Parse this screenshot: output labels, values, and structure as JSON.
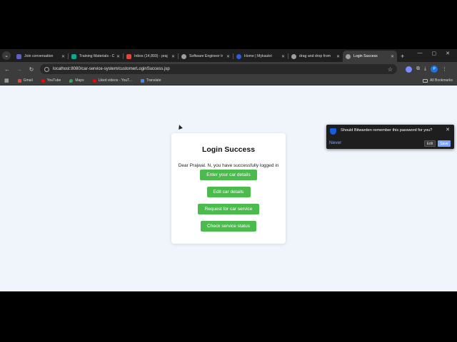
{
  "tabs": [
    {
      "title": "Join conversation",
      "color": "#5b5fc7",
      "active": false
    },
    {
      "title": "Training Materials - C",
      "color": "#0fa58e",
      "active": false
    },
    {
      "title": "Inbox (14,893) - praj",
      "color": "#ea4335",
      "active": false
    },
    {
      "title": "Software Engineer Ir",
      "color": "#9aa0a6",
      "active": false
    },
    {
      "title": "Home | Mykaukri",
      "color": "#2d5be3",
      "active": false
    },
    {
      "title": "drag and drop from",
      "color": "#9aa0a6",
      "active": false
    },
    {
      "title": "Login Success",
      "color": "#9aa0a6",
      "active": true
    }
  ],
  "toolbar": {
    "url": "localhost:8080/car-service-system/customerLoginSuccess.jsp",
    "avatar_letter": "P"
  },
  "bookmarks": [
    {
      "label": "Gmail",
      "color": "#ea4335"
    },
    {
      "label": "YouTube",
      "color": "#ff0000"
    },
    {
      "label": "Maps",
      "color": "#34a853"
    },
    {
      "label": "Liked videos - YouT...",
      "color": "#ff0000"
    },
    {
      "label": "Translate",
      "color": "#4285f4"
    }
  ],
  "all_bookmarks": "All Bookmarks",
  "card": {
    "title": "Login Success",
    "message": "Dear Prajwal. N, you have successfully logged in",
    "buttons": [
      "Enter your car details",
      "Edit car details",
      "Request for car service",
      "Check service status"
    ]
  },
  "bitwarden": {
    "message": "Should Bitwarden remember this password for you?",
    "never": "Never",
    "edit": "Edit",
    "save": "Save"
  }
}
